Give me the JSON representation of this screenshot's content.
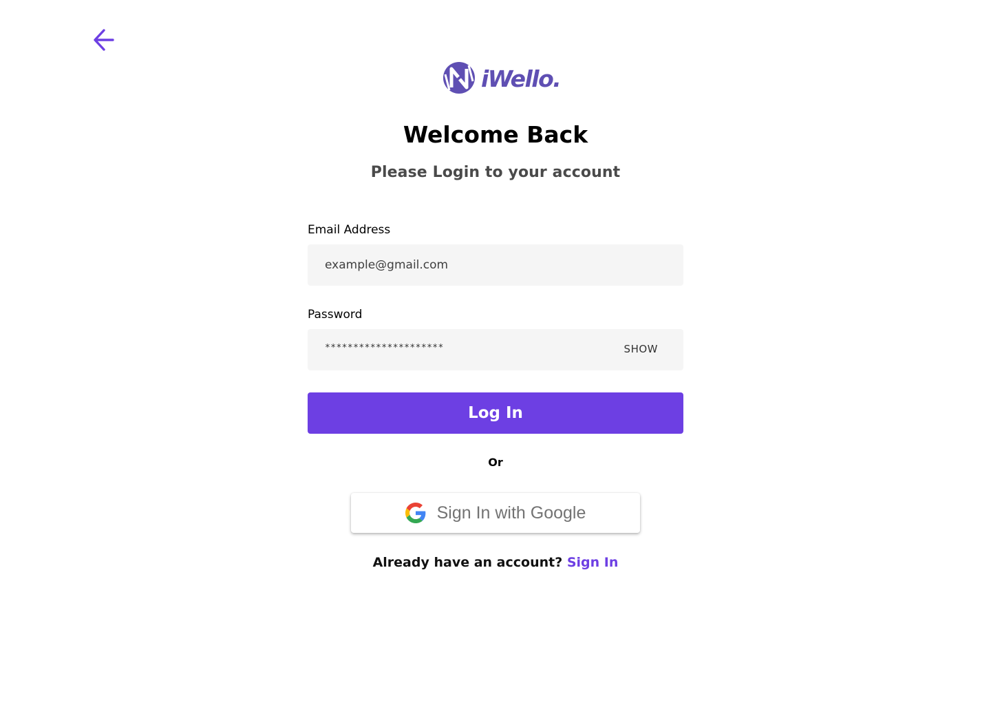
{
  "brand": {
    "name": "iWello.",
    "color": "#5f4fb3",
    "accent_color": "#6d3fe3"
  },
  "nav": {
    "back_icon": "arrow-left-icon"
  },
  "header": {
    "title": "Welcome Back",
    "subtitle": "Please Login to your account"
  },
  "form": {
    "email": {
      "label": "Email Address",
      "placeholder": "example@gmail.com",
      "value": ""
    },
    "password": {
      "label": "Password",
      "value": "*********************",
      "toggle_label": "SHOW"
    },
    "submit_label": "Log In"
  },
  "divider": {
    "text": "Or"
  },
  "social": {
    "google_label": "Sign In with Google",
    "google_icon": "google-icon"
  },
  "footer": {
    "prompt": "Already have an account?",
    "link_label": "Sign In"
  }
}
